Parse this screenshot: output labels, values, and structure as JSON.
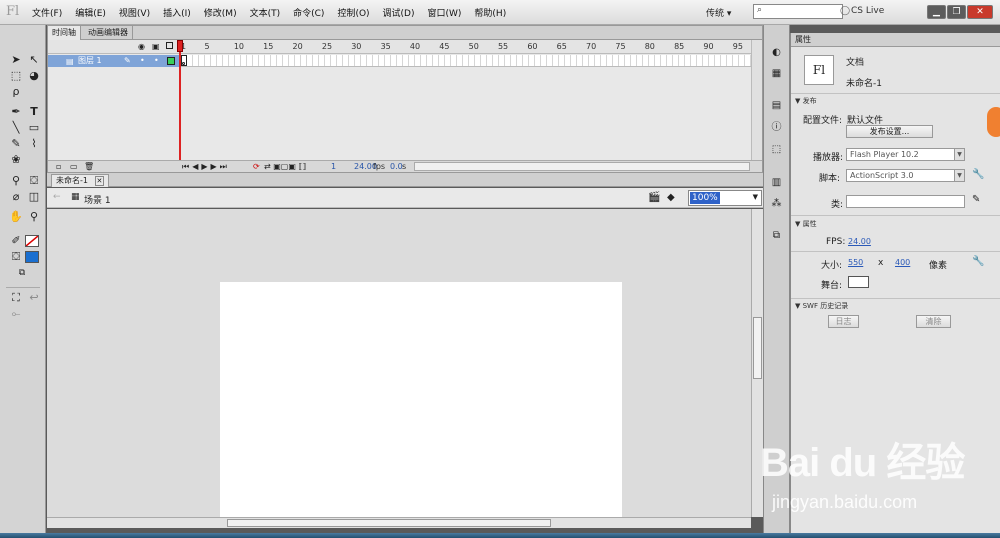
{
  "app": {
    "logo": "Fl"
  },
  "menubar": {
    "items": [
      "文件(F)",
      "编辑(E)",
      "视图(V)",
      "插入(I)",
      "修改(M)",
      "文本(T)",
      "命令(C)",
      "控制(O)",
      "调试(D)",
      "窗口(W)",
      "帮助(H)"
    ],
    "workspace": "传统 ▾",
    "search_placeholder": "",
    "cs_live": "CS Live"
  },
  "timeline": {
    "tabs": [
      "时间轴",
      "动画编辑器"
    ],
    "frame_numbers": [
      "1",
      "5",
      "10",
      "15",
      "20",
      "25",
      "30",
      "35",
      "40",
      "45",
      "50",
      "55",
      "60",
      "65",
      "70",
      "75",
      "80",
      "85",
      "90",
      "95"
    ],
    "layer_name": "图层 1",
    "current_frame": "1",
    "fps": "24.00",
    "fps_unit": "fps",
    "elapsed": "0.0",
    "elapsed_unit": "s"
  },
  "document": {
    "tab_name": "未命名-1",
    "scene": "场景 1",
    "zoom": "100%"
  },
  "properties": {
    "tab": "属性",
    "doc_type": "文档",
    "doc_icon": "Fl",
    "doc_name": "未命名-1",
    "publish_section": "发布",
    "profile_label": "配置文件:",
    "profile_value": "默认文件",
    "publish_settings_btn": "发布设置...",
    "player_label": "播放器:",
    "player_value": "Flash Player 10.2",
    "script_label": "脚本:",
    "script_value": "ActionScript 3.0",
    "class_label": "类:",
    "class_value": "",
    "props_section": "属性",
    "fps_label": "FPS:",
    "fps_value": "24.00",
    "size_label": "大小:",
    "width": "550",
    "x_sep": "x",
    "height": "400",
    "unit": "像素",
    "stage_label": "舞台:",
    "swf_section": "SWF 历史记录",
    "log_btn": "日志",
    "clear_btn": "清除"
  },
  "watermark": {
    "text": "Bai du 经验",
    "url": "jingyan.baidu.com"
  },
  "colors": {
    "layer_highlight": "#7fa4d8",
    "playhead": "#d22222",
    "fill": "#1a6fd0",
    "accent_link": "#2a59b8"
  }
}
